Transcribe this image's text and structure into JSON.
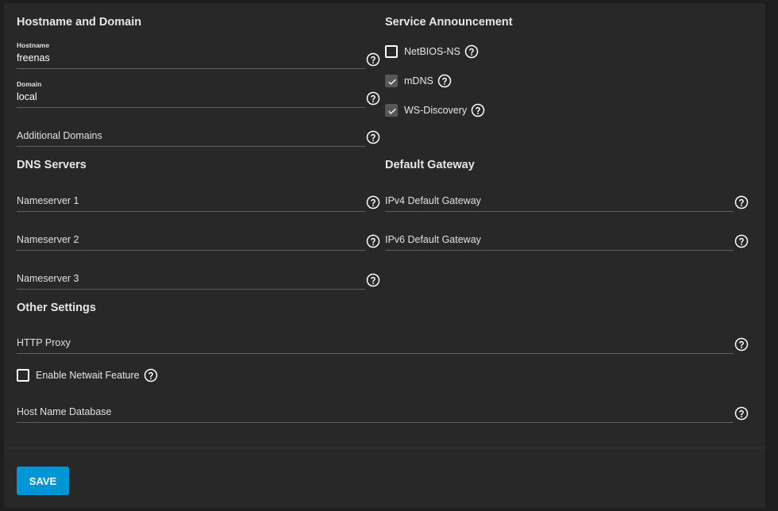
{
  "sections": {
    "hostname_domain": "Hostname and Domain",
    "service_announcement": "Service Announcement",
    "dns_servers": "DNS Servers",
    "default_gateway": "Default Gateway",
    "other_settings": "Other Settings"
  },
  "fields": {
    "hostname": {
      "label": "Hostname",
      "value": "freenas"
    },
    "domain": {
      "label": "Domain",
      "value": "local"
    },
    "additional_domains": {
      "label": "Additional Domains",
      "value": ""
    },
    "nameserver1": {
      "label": "Nameserver 1",
      "value": ""
    },
    "nameserver2": {
      "label": "Nameserver 2",
      "value": ""
    },
    "nameserver3": {
      "label": "Nameserver 3",
      "value": ""
    },
    "ipv4_gateway": {
      "label": "IPv4 Default Gateway",
      "value": ""
    },
    "ipv6_gateway": {
      "label": "IPv6 Default Gateway",
      "value": ""
    },
    "http_proxy": {
      "label": "HTTP Proxy",
      "value": ""
    },
    "host_name_database": {
      "label": "Host Name Database",
      "value": ""
    }
  },
  "checkboxes": {
    "netbios_ns": {
      "label": "NetBIOS-NS",
      "checked": false
    },
    "mdns": {
      "label": "mDNS",
      "checked": true
    },
    "ws_discovery": {
      "label": "WS-Discovery",
      "checked": true
    },
    "netwait": {
      "label": "Enable Netwait Feature",
      "checked": false
    }
  },
  "icons": {
    "help": "help-circle-icon",
    "check": "checkmark-icon"
  },
  "colors": {
    "background": "#1e1e1e",
    "card": "#282828",
    "primary": "#0095d5",
    "checked_box": "#575757",
    "underline": "#5f5f5f"
  },
  "buttons": {
    "save": "SAVE"
  }
}
